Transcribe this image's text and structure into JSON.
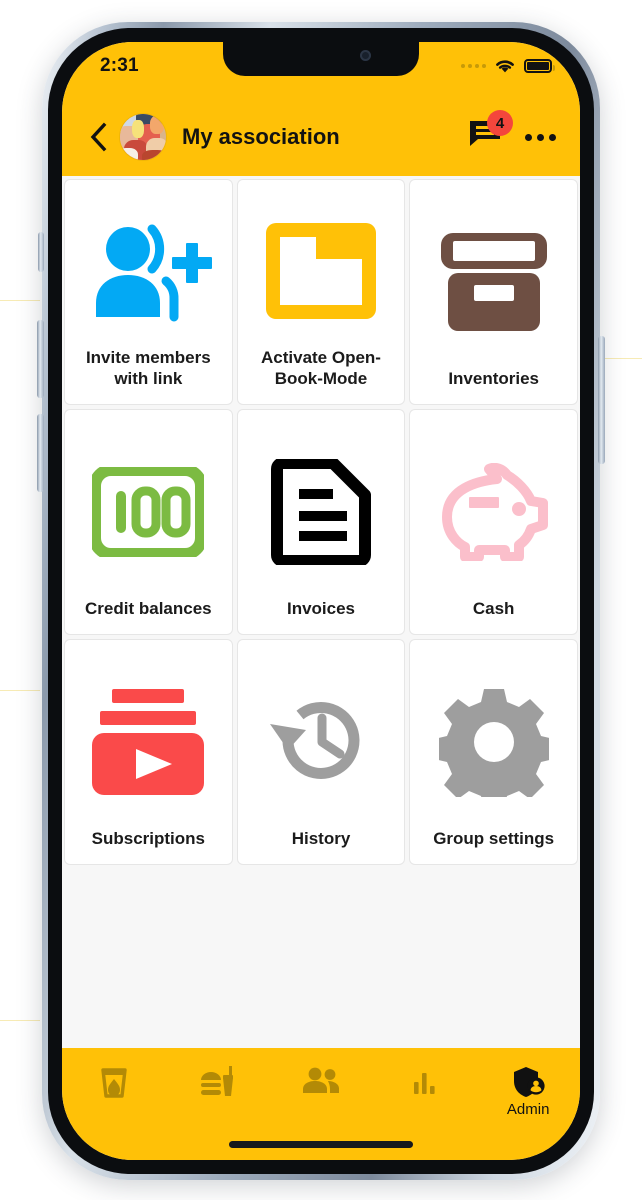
{
  "theme": {
    "brand_yellow": "#FFC107",
    "screen_bg": "#F7F7F7",
    "tile_bg": "#FFFFFF",
    "text_dark": "#1B1B1B",
    "badge_red": "#F4463C"
  },
  "status_bar": {
    "time": "2:31",
    "signal_icon": "signal-dots-icon",
    "wifi_icon": "wifi-icon",
    "battery_icon": "battery-full-icon"
  },
  "app_bar": {
    "back_icon": "chevron-left-icon",
    "avatar_icon": "group-avatar-photo",
    "title": "My association",
    "chat_icon": "chat-bubble-icon",
    "chat_badge_count": "4",
    "overflow_icon": "more-horizontal-icon"
  },
  "grid": {
    "tiles": [
      {
        "label": "Invite members with link",
        "icon": "person-add-icon",
        "color": "#03A9F4"
      },
      {
        "label": "Activate Open-Book-Mode",
        "icon": "open-folder-icon",
        "color": "#FFC107"
      },
      {
        "label": "Inventories",
        "icon": "archive-box-icon",
        "color": "#6E4F43"
      },
      {
        "label": "Credit balances",
        "icon": "banknote-100-icon",
        "color": "#7CBB42"
      },
      {
        "label": "Invoices",
        "icon": "document-lines-icon",
        "color": "#000000"
      },
      {
        "label": "Cash",
        "icon": "piggy-bank-icon",
        "color": "#FBBFCB"
      },
      {
        "label": "Subscriptions",
        "icon": "video-play-icon",
        "color": "#FA4A4A"
      },
      {
        "label": "History",
        "icon": "history-clock-icon",
        "color": "#9E9E9E"
      },
      {
        "label": "Group settings",
        "icon": "gear-icon",
        "color": "#9E9E9E"
      }
    ]
  },
  "bottom_nav": {
    "items": [
      {
        "label": "",
        "icon": "drink-glass-icon",
        "active": false
      },
      {
        "label": "",
        "icon": "fast-food-icon",
        "active": false
      },
      {
        "label": "",
        "icon": "people-icon",
        "active": false
      },
      {
        "label": "",
        "icon": "bar-chart-icon",
        "active": false
      },
      {
        "label": "Admin",
        "icon": "shield-person-icon",
        "active": true
      }
    ]
  }
}
